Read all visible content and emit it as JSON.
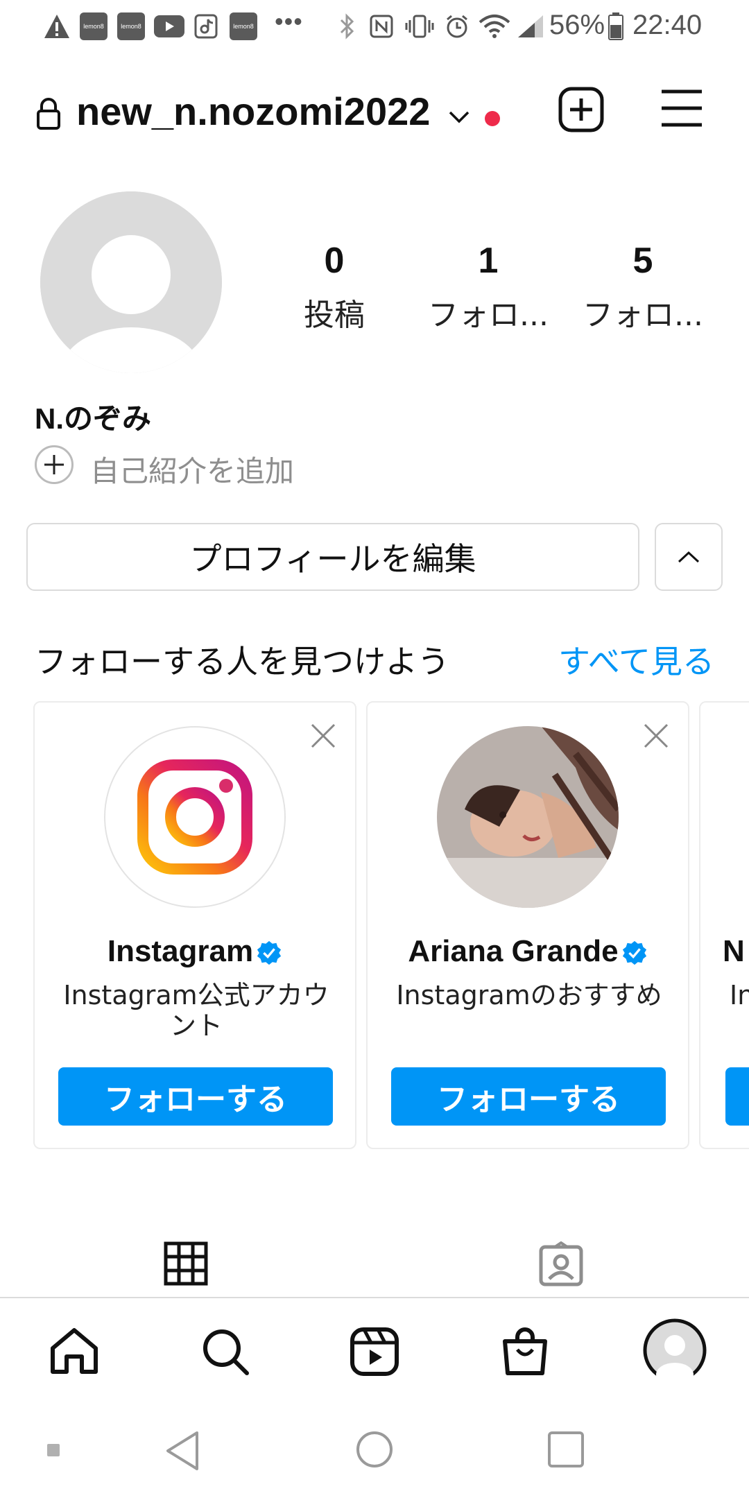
{
  "status_bar": {
    "app_icons": [
      "alert-icon",
      "lemon8-app-icon",
      "lemon8-app-icon",
      "youtube-app-icon",
      "tiktok-app-icon",
      "lemon8-app-icon"
    ],
    "app_icon_text": "lemon8",
    "more": "•••",
    "battery": "56%",
    "time": "22:40"
  },
  "header": {
    "username": "new_n.nozomi2022"
  },
  "profile": {
    "stats": [
      {
        "value": "0",
        "label": "投稿"
      },
      {
        "value": "1",
        "label": "フォロ..."
      },
      {
        "value": "5",
        "label": "フォロ..."
      }
    ],
    "display_name": "N.のぞみ",
    "bio_add": "自己紹介を追加",
    "edit_button": "プロフィールを編集"
  },
  "discover": {
    "title": "フォローする人を見つけよう",
    "see_all": "すべて見る",
    "cards": [
      {
        "name": "Instagram",
        "subtitle": "Instagram公式アカウント",
        "button": "フォローする",
        "verified": true
      },
      {
        "name": "Ariana Grande",
        "subtitle": "Instagramのおすすめ",
        "button": "フォローする",
        "verified": true
      },
      {
        "name": "N",
        "subtitle": "In",
        "button": "",
        "verified": false
      }
    ]
  },
  "colors": {
    "accent": "#0095f6",
    "notification_dot": "#ee2a4a"
  }
}
